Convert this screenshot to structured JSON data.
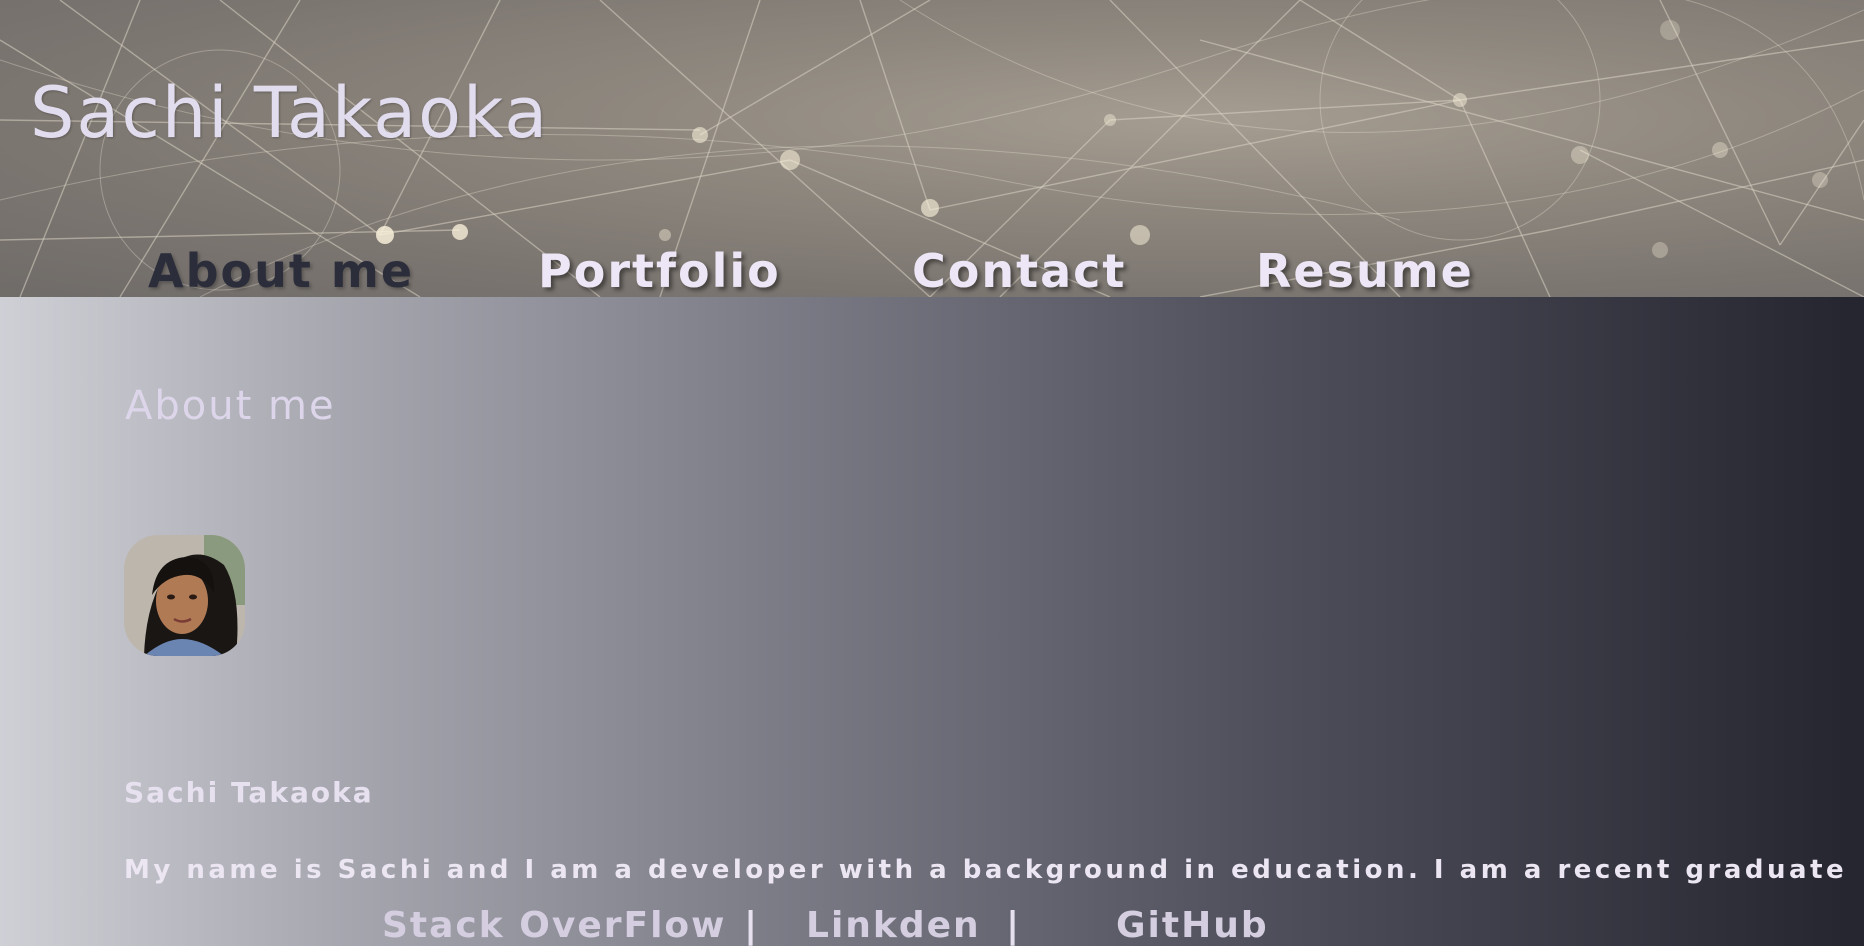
{
  "header": {
    "site_title": "Sachi Takaoka",
    "nav": [
      {
        "label": "About me",
        "active": true
      },
      {
        "label": "Portfolio",
        "active": false
      },
      {
        "label": "Contact",
        "active": false
      },
      {
        "label": "Resume",
        "active": false
      }
    ]
  },
  "main": {
    "section_heading": "About me",
    "avatar_icon": "profile-photo",
    "profile_name": "Sachi Takaoka",
    "bio": "My name is Sachi and I am a developer with a background in education. I am a recent graduate"
  },
  "footer": {
    "links": [
      "Stack OverFlow",
      "Linkden",
      "GitHub"
    ],
    "separator": "|"
  },
  "colors": {
    "nav_active": "#2b2d3a",
    "nav_inactive": "#ede6f6",
    "gradient_start": "#cfcfd6",
    "gradient_end": "#25252f"
  }
}
